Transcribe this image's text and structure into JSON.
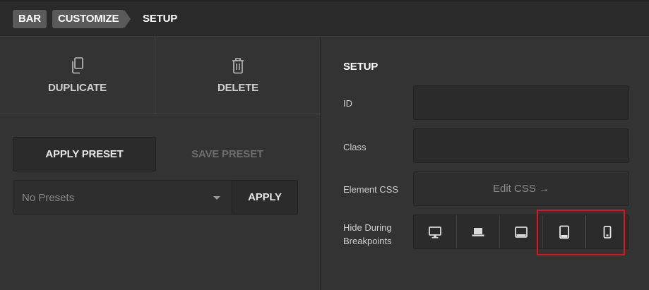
{
  "breadcrumb": {
    "items": [
      "BAR",
      "CUSTOMIZE",
      "SETUP"
    ]
  },
  "actions": {
    "duplicate_label": "DUPLICATE",
    "delete_label": "DELETE",
    "duplicate_icon": "copy-icon",
    "delete_icon": "trash-icon"
  },
  "presets": {
    "apply_preset_label": "APPLY PRESET",
    "save_preset_label": "SAVE PRESET",
    "select_value": "No Presets",
    "apply_label": "APPLY"
  },
  "setup": {
    "title": "SETUP",
    "id_label": "ID",
    "id_value": "",
    "class_label": "Class",
    "class_value": "",
    "element_css_label": "Element CSS",
    "edit_css_label": "Edit CSS →",
    "hide_label_line1": "Hide During",
    "hide_label_line2": "Breakpoints",
    "breakpoints": [
      {
        "icon": "desktop-icon",
        "active": false
      },
      {
        "icon": "laptop-icon",
        "active": false
      },
      {
        "icon": "tablet-landscape-icon",
        "active": false
      },
      {
        "icon": "tablet-portrait-icon",
        "active": true
      },
      {
        "icon": "mobile-icon",
        "active": true
      }
    ]
  },
  "colors": {
    "background": "#333333",
    "header": "#2a2a2a",
    "pill": "#5a5a5a",
    "highlight": "#e0141e"
  }
}
